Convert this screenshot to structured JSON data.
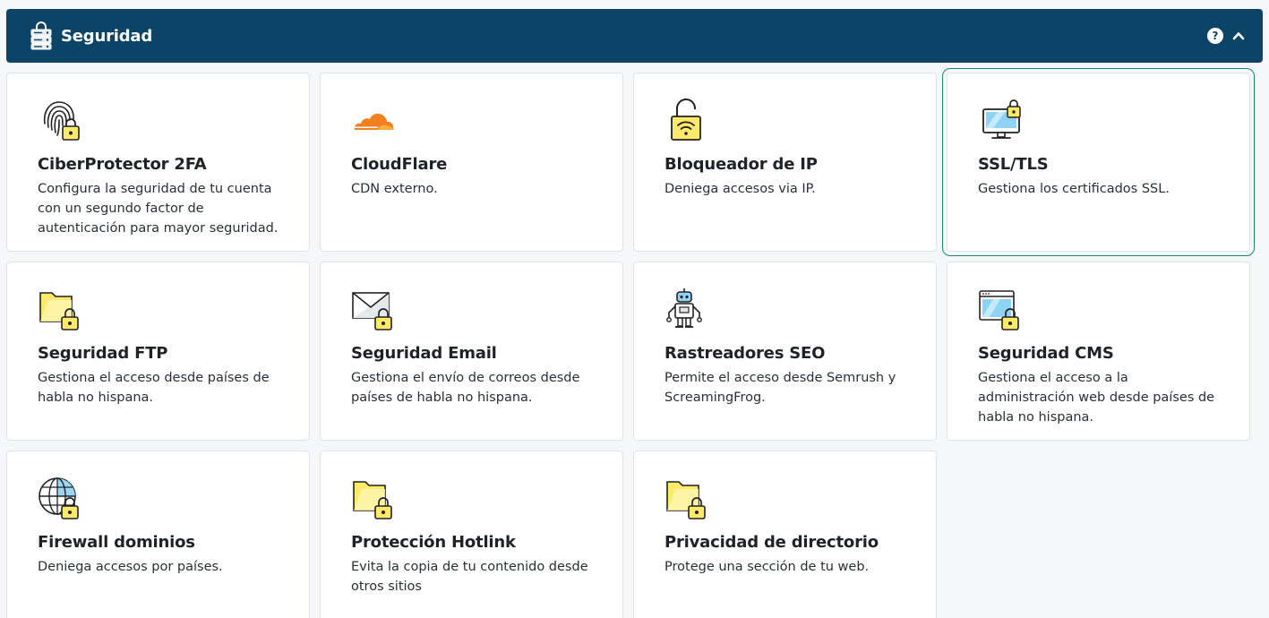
{
  "header": {
    "title": "Seguridad",
    "icon": "server-lock-icon",
    "help_icon": "help-icon",
    "help_glyph": "?",
    "collapse_icon": "chevron-up-icon",
    "color": "#0b4466"
  },
  "cards": [
    {
      "id": "2fa",
      "icon": "fingerprint-lock-icon",
      "title": "CiberProtector 2FA",
      "desc": "Configura la seguridad de tu cuenta con un segundo factor de autenticación para mayor seguridad."
    },
    {
      "id": "cloudflare",
      "icon": "cloudflare-icon",
      "title": "CloudFlare",
      "desc": "CDN externo."
    },
    {
      "id": "ipblock",
      "icon": "wifi-lock-icon",
      "title": "Bloqueador de IP",
      "desc": "Deniega accesos via IP."
    },
    {
      "id": "ssl",
      "icon": "monitor-lock-icon",
      "title": "SSL/TLS",
      "desc": "Gestiona los certificados SSL.",
      "selected": true
    },
    {
      "id": "ftp",
      "icon": "folder-lock-icon",
      "title": "Seguridad FTP",
      "desc": "Gestiona el acceso desde países de habla no hispana."
    },
    {
      "id": "email",
      "icon": "envelope-lock-icon",
      "title": "Seguridad Email",
      "desc": "Gestiona el envío de correos desde países de habla no hispana."
    },
    {
      "id": "seo",
      "icon": "robot-icon",
      "title": "Rastreadores SEO",
      "desc": "Permite el acceso desde Semrush y ScreamingFrog."
    },
    {
      "id": "cms",
      "icon": "browser-lock-icon",
      "title": "Seguridad CMS",
      "desc": "Gestiona el acceso a la administración web desde países de habla no hispana."
    },
    {
      "id": "firewall",
      "icon": "globe-lock-icon",
      "title": "Firewall dominios",
      "desc": "Deniega accesos por países."
    },
    {
      "id": "hotlink",
      "icon": "folder-lock-icon",
      "title": "Protección Hotlink",
      "desc": "Evita la copia de tu contenido desde otros sitios"
    },
    {
      "id": "dirprivacy",
      "icon": "folder-lock-icon",
      "title": "Privacidad de directorio",
      "desc": "Protege una sección de tu web."
    }
  ],
  "colors": {
    "accent_yellow": "#fde96a",
    "accent_blue": "#8fd3f4",
    "cloudflare_orange": "#f38020",
    "selected_outline": "#138a60"
  }
}
